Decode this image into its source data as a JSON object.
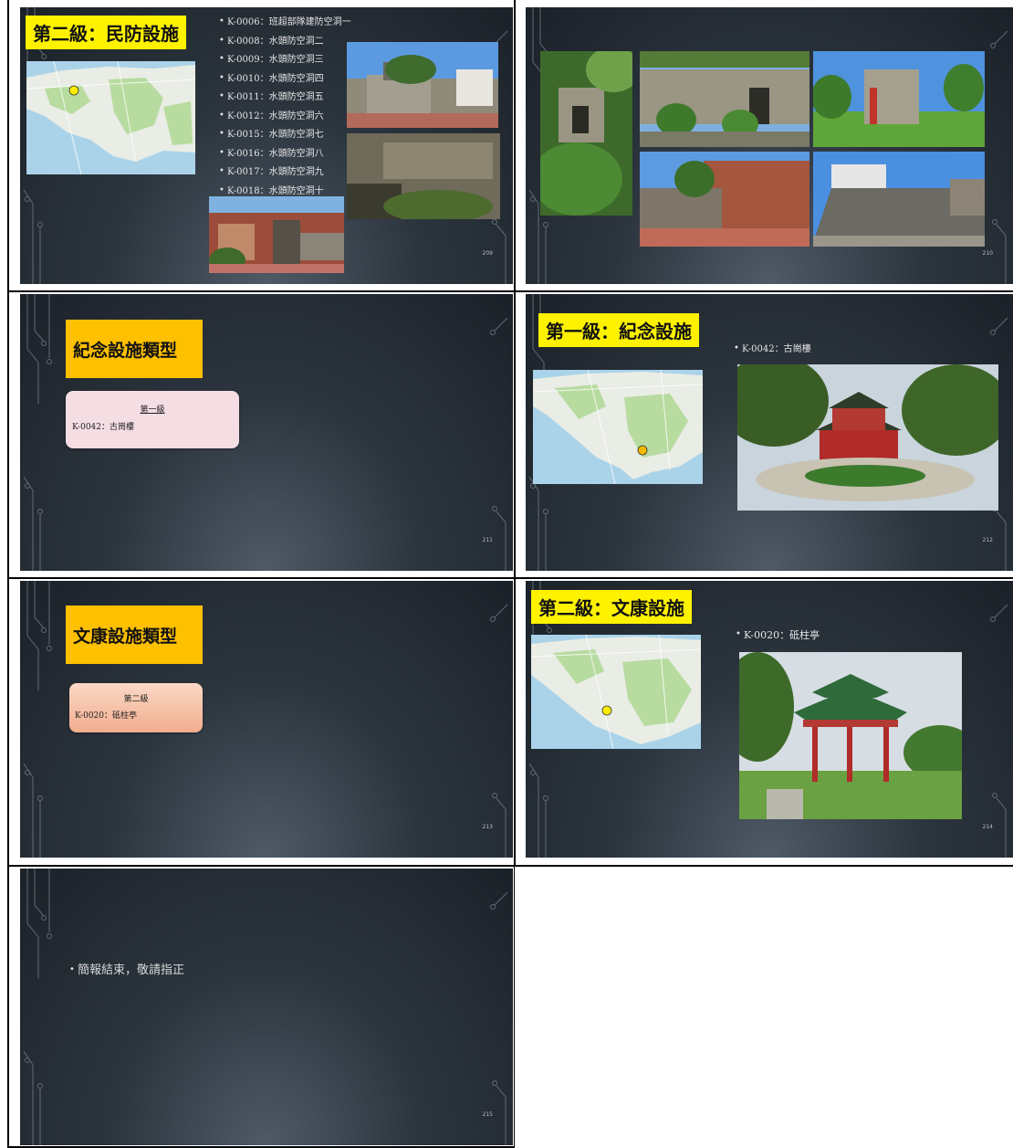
{
  "slides": [
    {
      "number": "209",
      "title": "第二級：民防設施",
      "items": [
        "K-0006：班超部隊建防空洞一",
        "K-0008：水頭防空洞二",
        "K-0009：水頭防空洞三",
        "K-0010：水頭防空洞四",
        "K-0011：水頭防空洞五",
        "K-0012：水頭防空洞六",
        "K-0015：水頭防空洞七",
        "K-0016：水頭防空洞八",
        "K-0017：水頭防空洞九",
        "K-0018：水頭防空洞十"
      ],
      "map_marker_color": "#ffee00"
    },
    {
      "number": "210"
    },
    {
      "number": "211",
      "type_title": "紀念設施類型",
      "card_level": "第一級",
      "card_item": "K-0042：古崗樓",
      "card_color": "#f4dde3"
    },
    {
      "number": "212",
      "title": "第一級：紀念設施",
      "items": [
        "K-0042：古崗樓"
      ],
      "map_marker_color": "#f5b800"
    },
    {
      "number": "213",
      "type_title": "文康設施類型",
      "card_level": "第二級",
      "card_item": "K-0020：砥柱亭",
      "card_color": "#f6c0a6"
    },
    {
      "number": "214",
      "title": "第二級：文康設施",
      "items": [
        "K-0020：砥柱亭"
      ],
      "map_marker_color": "#ffee00"
    },
    {
      "number": "215",
      "items": [
        "簡報結束，敬請指正"
      ]
    }
  ],
  "colors": {
    "title_yellow": "#fff200",
    "type_orange": "#ffc000",
    "slide_dark": "#1b2128"
  }
}
